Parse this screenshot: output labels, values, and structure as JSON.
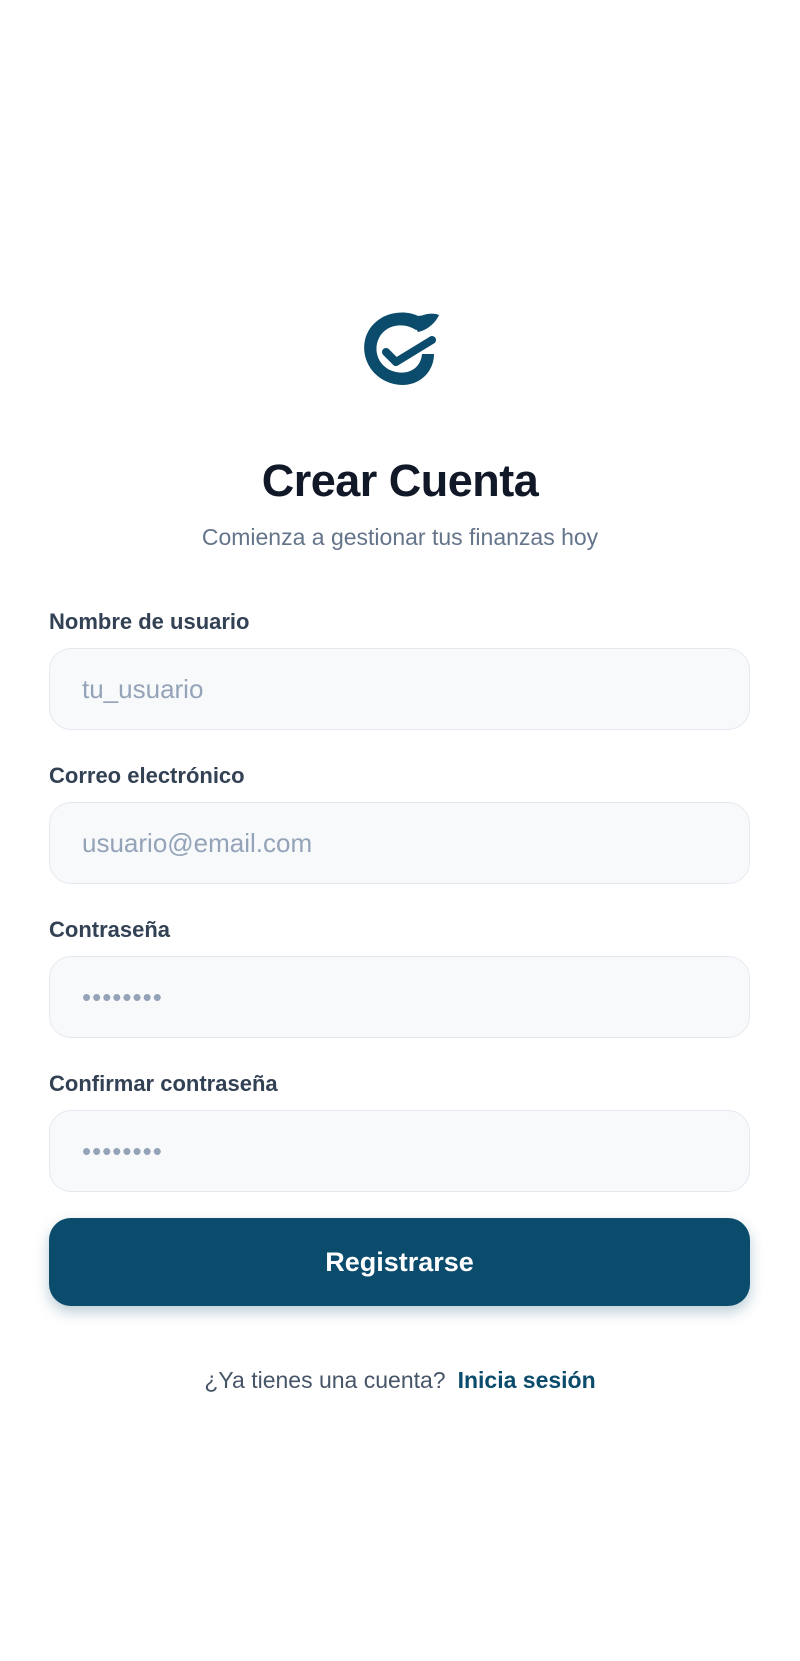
{
  "header": {
    "logo_icon": "check-circle-logo-icon",
    "title": "Crear Cuenta",
    "subtitle": "Comienza a gestionar tus finanzas hoy"
  },
  "form": {
    "username": {
      "label": "Nombre de usuario",
      "placeholder": "tu_usuario",
      "value": ""
    },
    "email": {
      "label": "Correo electrónico",
      "placeholder": "usuario@email.com",
      "value": ""
    },
    "password": {
      "label": "Contraseña",
      "placeholder": "••••••••",
      "value": ""
    },
    "confirm_password": {
      "label": "Confirmar contraseña",
      "placeholder": "••••••••",
      "value": ""
    },
    "submit_label": "Registrarse"
  },
  "footer": {
    "question": "¿Ya tienes una cuenta?",
    "link_label": "Inicia sesión"
  },
  "colors": {
    "brand": "#0b4b6b",
    "title": "#111827",
    "muted": "#64748b",
    "input_bg": "#f7f9fb",
    "input_border": "#e5e9ef"
  }
}
